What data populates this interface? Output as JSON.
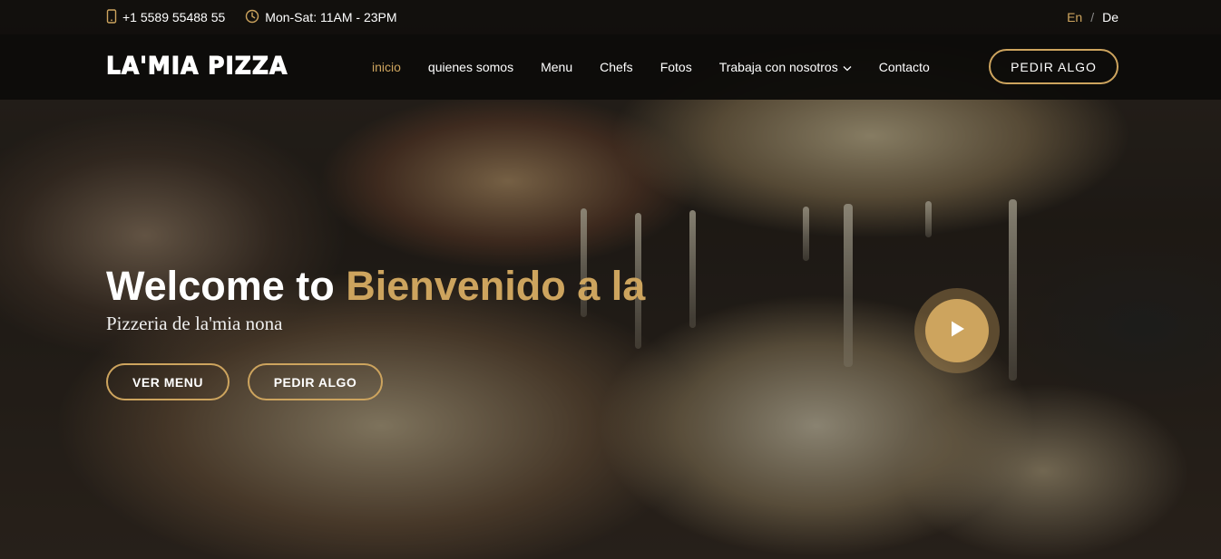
{
  "topbar": {
    "phone": "+1 5589 55488 55",
    "hours": "Mon-Sat: 11AM - 23PM",
    "lang_en": "En",
    "lang_sep": "/",
    "lang_de": "De"
  },
  "header": {
    "logo": "LA'MIA PIZZA",
    "nav": [
      {
        "label": "inicio",
        "active": true
      },
      {
        "label": "quienes somos"
      },
      {
        "label": "Menu"
      },
      {
        "label": "Chefs"
      },
      {
        "label": "Fotos"
      },
      {
        "label": "Trabaja con nosotros",
        "dropdown": true
      },
      {
        "label": "Contacto"
      }
    ],
    "order_button": "PEDIR ALGO"
  },
  "hero": {
    "title_main": "Welcome to ",
    "title_accent": "Bienvenido a la",
    "subtitle": "Pizzeria de la'mia nona",
    "btn_menu": "VER MENU",
    "btn_order": "PEDIR ALGO"
  },
  "colors": {
    "accent": "#cda45e",
    "background": "#0c0b09"
  },
  "icons": [
    "phone-icon",
    "clock-icon",
    "chevron-down-icon",
    "play-icon"
  ]
}
